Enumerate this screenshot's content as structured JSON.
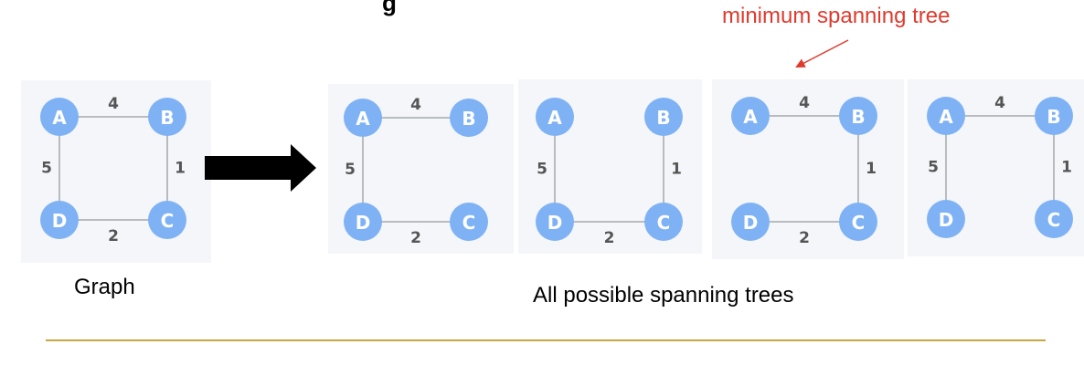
{
  "annotation": {
    "text": "minimum spanning tree",
    "color": "#e03a2e"
  },
  "partial_heading_glyph": "g",
  "captions": {
    "graph": "Graph",
    "spanning_trees": "All possible spanning trees"
  },
  "colors": {
    "node": "#7fb2f5",
    "edge": "#b9bcbf",
    "panel_bg": "#f4f6f9",
    "divider": "#c9a642",
    "arrow": "#000000"
  },
  "graphs": [
    {
      "id": "original-graph",
      "nodes": [
        "A",
        "B",
        "C",
        "D"
      ],
      "edges": [
        {
          "from": "A",
          "to": "B",
          "weight": "4"
        },
        {
          "from": "B",
          "to": "C",
          "weight": "1"
        },
        {
          "from": "C",
          "to": "D",
          "weight": "2"
        },
        {
          "from": "D",
          "to": "A",
          "weight": "5"
        }
      ]
    },
    {
      "id": "spanning-tree-1",
      "nodes": [
        "A",
        "B",
        "C",
        "D"
      ],
      "edges": [
        {
          "from": "A",
          "to": "B",
          "weight": "4"
        },
        {
          "from": "D",
          "to": "A",
          "weight": "5"
        },
        {
          "from": "C",
          "to": "D",
          "weight": "2"
        }
      ]
    },
    {
      "id": "spanning-tree-2",
      "nodes": [
        "A",
        "B",
        "C",
        "D"
      ],
      "edges": [
        {
          "from": "D",
          "to": "A",
          "weight": "5"
        },
        {
          "from": "B",
          "to": "C",
          "weight": "1"
        },
        {
          "from": "C",
          "to": "D",
          "weight": "2"
        }
      ]
    },
    {
      "id": "spanning-tree-3",
      "nodes": [
        "A",
        "B",
        "C",
        "D"
      ],
      "edges": [
        {
          "from": "A",
          "to": "B",
          "weight": "4"
        },
        {
          "from": "B",
          "to": "C",
          "weight": "1"
        },
        {
          "from": "C",
          "to": "D",
          "weight": "2"
        }
      ]
    },
    {
      "id": "spanning-tree-4",
      "nodes": [
        "A",
        "B",
        "C",
        "D"
      ],
      "edges": [
        {
          "from": "A",
          "to": "B",
          "weight": "4"
        },
        {
          "from": "D",
          "to": "A",
          "weight": "5"
        },
        {
          "from": "B",
          "to": "C",
          "weight": "1"
        }
      ]
    }
  ]
}
